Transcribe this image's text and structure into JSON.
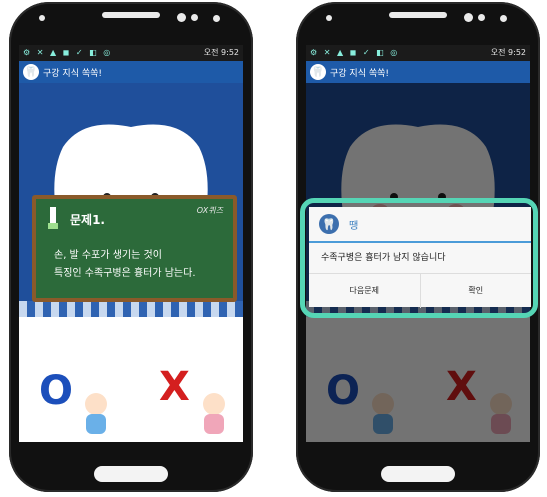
{
  "status_bar": {
    "left_icons": "⚙ ✕ ▲ ◼ ✓ ◧ ◎",
    "time": "오전 9:52"
  },
  "app_bar": {
    "title": "구강 지식 쏙쏙!"
  },
  "board": {
    "question_label": "문제1.",
    "badge": "OX퀴즈",
    "text_line1": "손, 발 수포가 생기는 것이",
    "text_line2": "특징인 수족구병은 흉터가 남는다."
  },
  "answers": {
    "o_label": "O",
    "x_label": "X"
  },
  "dialog": {
    "title": "땡",
    "message": "수족구병은 흉터가 남지 않습니다",
    "next_button": "다음문제",
    "confirm_button": "확인"
  },
  "colors": {
    "accent_blue": "#1e5aa8",
    "board_green": "#2c6a3a",
    "dialog_highlight": "#55d5b5",
    "o_color": "#1c4fbb",
    "x_color": "#d41f1f"
  }
}
